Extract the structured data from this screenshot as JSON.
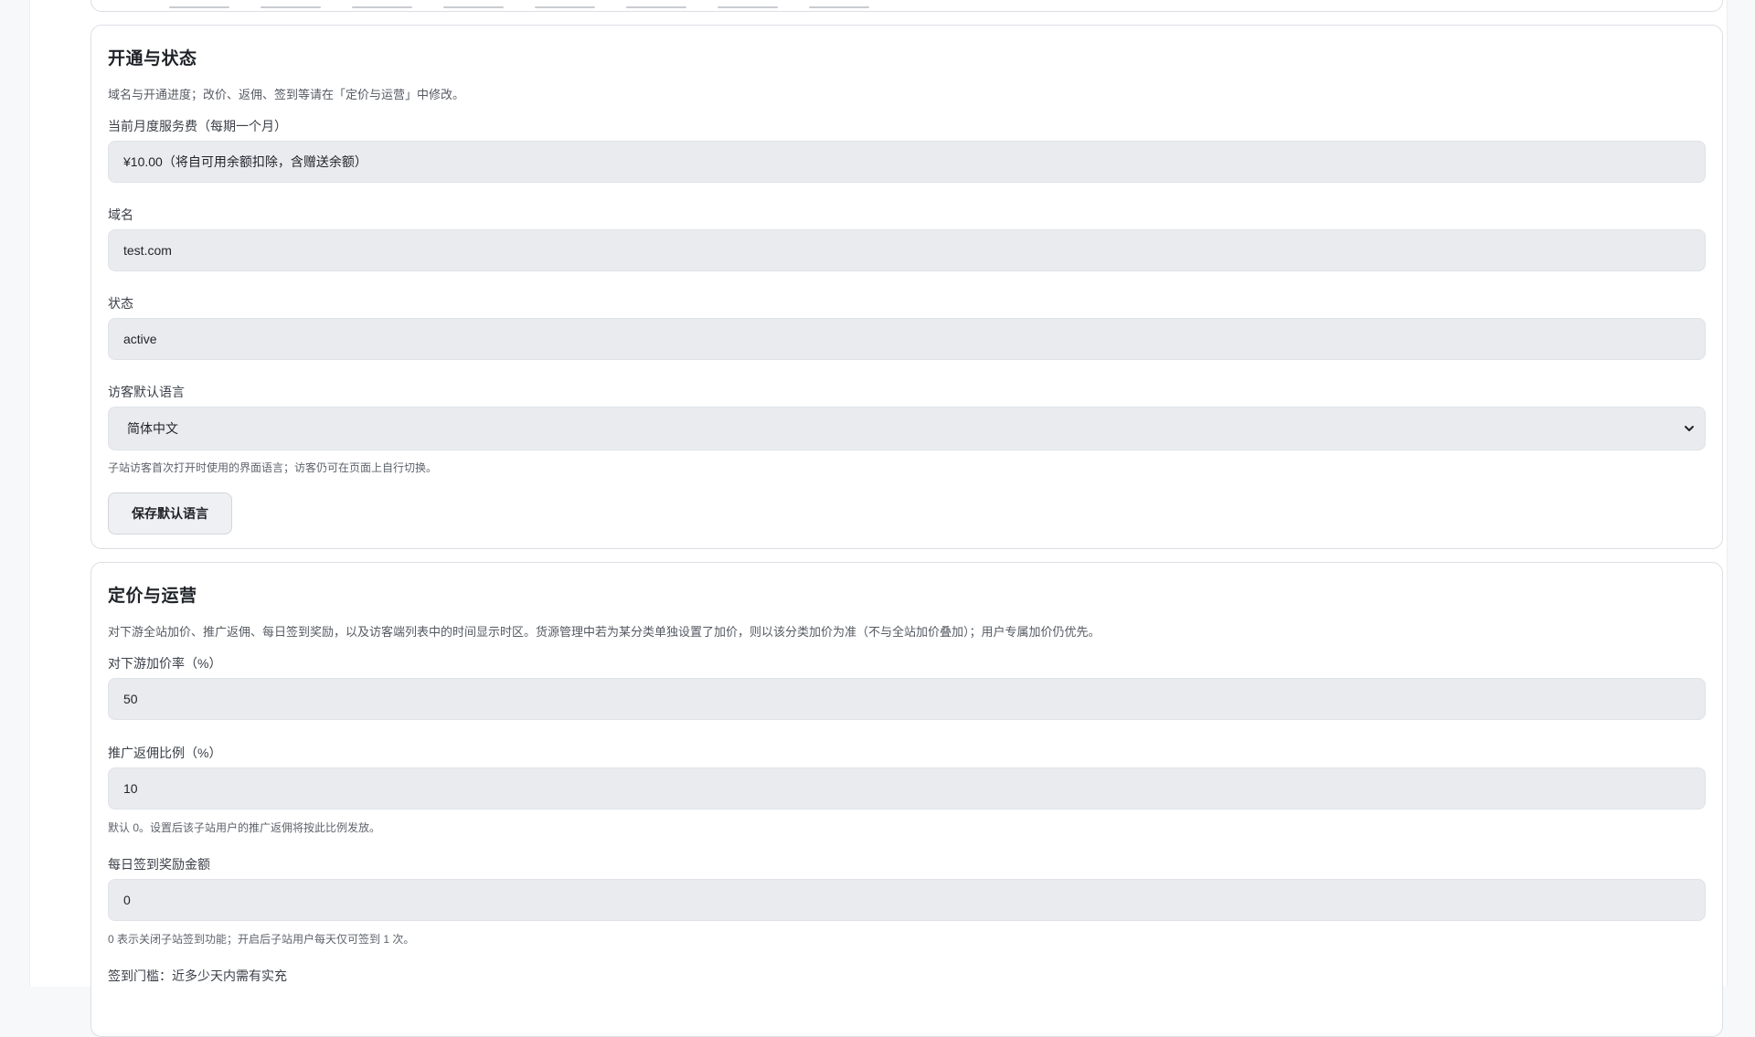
{
  "status_section": {
    "title": "开通与状态",
    "description": "域名与开通进度；改价、返佣、签到等请在「定价与运营」中修改。",
    "fields": [
      {
        "label": "当前月度服务费（每期一个月）",
        "value": "¥10.00（将自可用余额扣除，含赠送余额）"
      },
      {
        "label": "域名",
        "value": "test.com"
      },
      {
        "label": "状态",
        "value": "active"
      }
    ],
    "language": {
      "label": "访客默认语言",
      "selected": "简体中文",
      "hint": "子站访客首次打开时使用的界面语言；访客仍可在页面上自行切换。",
      "save_label": "保存默认语言"
    }
  },
  "pricing_section": {
    "title": "定价与运营",
    "description": "对下游全站加价、推广返佣、每日签到奖励，以及访客端列表中的时间显示时区。货源管理中若为某分类单独设置了加价，则以该分类加价为准（不与全站加价叠加）；用户专属加价仍优先。",
    "markup": {
      "label": "对下游加价率（%）",
      "value": "50"
    },
    "commission": {
      "label": "推广返佣比例（%）",
      "value": "10",
      "hint": "默认 0。设置后该子站用户的推广返佣将按此比例发放。"
    },
    "checkin": {
      "label": "每日签到奖励金额",
      "value": "0",
      "hint": "0 表示关闭子站签到功能；开启后子站用户每天仅可签到 1 次。"
    },
    "checkin_threshold": {
      "label": "签到门槛：近多少天内需有实充"
    }
  },
  "icons": {
    "select_chevron": "chevron-down-icon"
  }
}
